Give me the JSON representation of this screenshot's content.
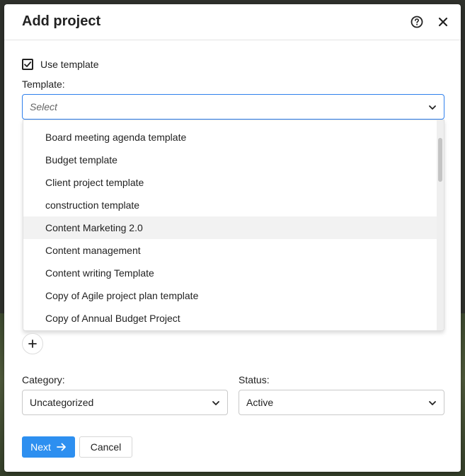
{
  "modal": {
    "title": "Add project"
  },
  "use_template": {
    "label": "Use template",
    "checked": true
  },
  "template": {
    "label": "Template:",
    "placeholder": "Select",
    "options": [
      "Board meeting agenda template",
      "Budget template",
      "Client project template",
      "construction template",
      "Content Marketing 2.0",
      "Content management",
      "Content writing Template",
      "Copy of Agile project plan template",
      "Copy of Annual Budget Project"
    ],
    "hovered_option": "Content Marketing 2.0"
  },
  "category": {
    "label": "Category:",
    "value": "Uncategorized"
  },
  "status": {
    "label": "Status:",
    "value": "Active"
  },
  "buttons": {
    "next": "Next",
    "cancel": "Cancel"
  },
  "icons": {
    "help": "help-icon",
    "close": "close-icon",
    "chevron": "chevron-down-icon",
    "plus": "plus-icon",
    "arrow": "arrow-right-icon",
    "check": "check-icon"
  },
  "colors": {
    "accent": "#2d8ff0",
    "focus_border": "#2f80ed"
  }
}
